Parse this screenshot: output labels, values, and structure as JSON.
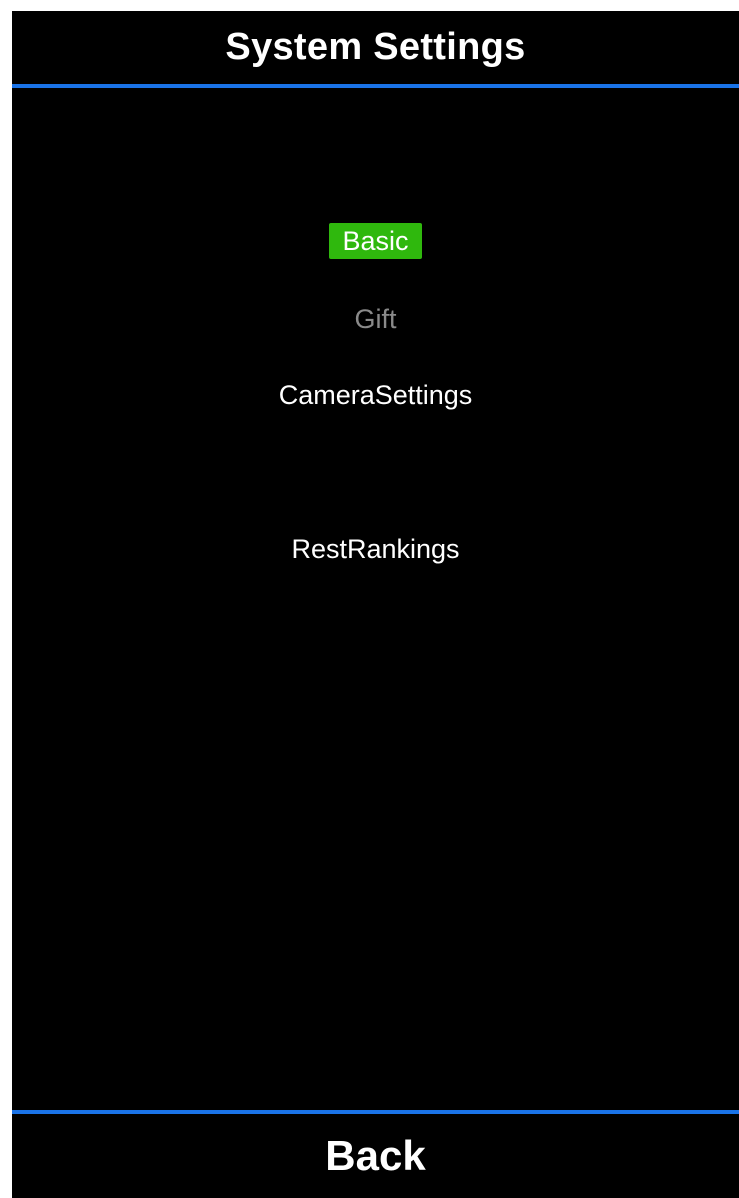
{
  "header": {
    "title": "System Settings"
  },
  "menu": {
    "items": [
      {
        "label": "Basic",
        "state": "selected"
      },
      {
        "label": "Gift",
        "state": "disabled"
      },
      {
        "label": "CameraSettings",
        "state": "normal"
      },
      {
        "label": "RestRankings",
        "state": "normal"
      }
    ]
  },
  "footer": {
    "back_label": "Back"
  },
  "colors": {
    "background": "#000000",
    "divider": "#1a73e8",
    "selected_bg": "#2fb80d",
    "text": "#ffffff",
    "disabled_text": "#8a8a8a"
  }
}
